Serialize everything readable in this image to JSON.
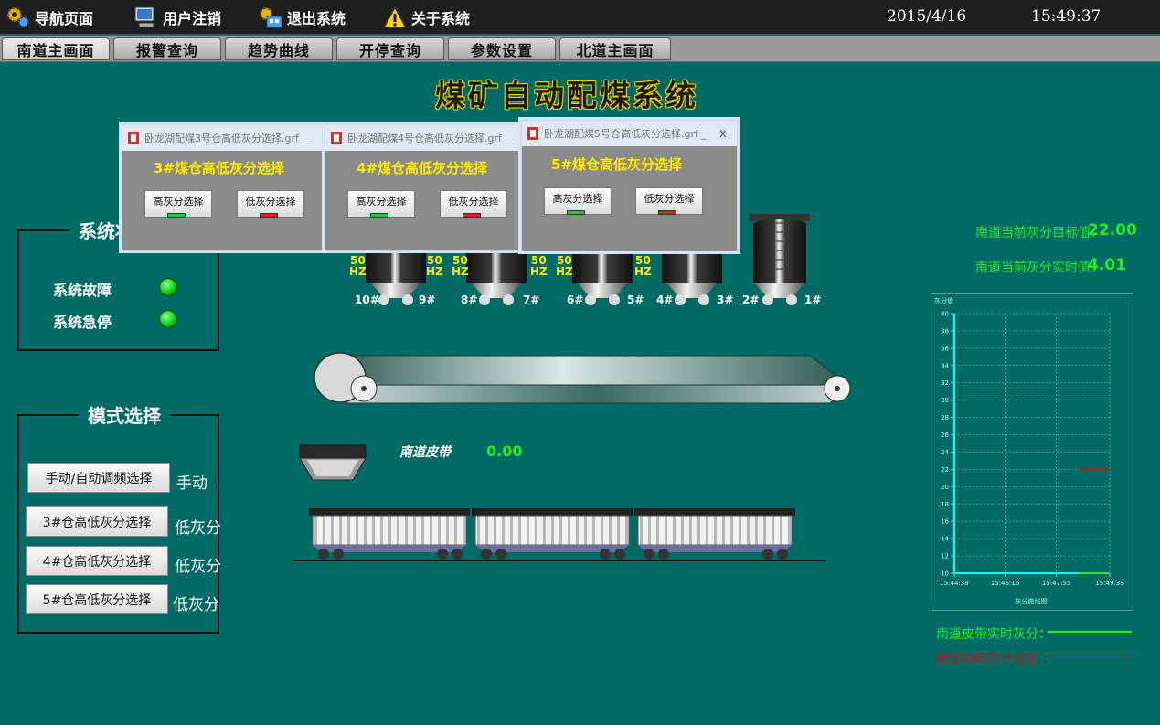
{
  "topbar": {
    "items": [
      {
        "label": "导航页面",
        "icon": "gear-icon"
      },
      {
        "label": "用户注销",
        "icon": "computer-icon"
      },
      {
        "label": "退出系统",
        "icon": "factory-icon"
      },
      {
        "label": "关于系统",
        "icon": "warning-icon"
      }
    ],
    "date": "2015/4/16",
    "time": "15:49:37"
  },
  "tabs": [
    "南道主画面",
    "报警查询",
    "趋势曲线",
    "开停查询",
    "参数设置",
    "北道主画面"
  ],
  "title": "煤矿自动配煤系统",
  "status_panel": {
    "title": "系统状态",
    "items": [
      "系统故障",
      "系统急停"
    ]
  },
  "mode_panel": {
    "title": "模式选择",
    "rows": [
      {
        "button": "手动/自动调频选择",
        "value": "手动"
      },
      {
        "button": "3#仓高低灰分选择",
        "value": "低灰分"
      },
      {
        "button": "4#仓高低灰分选择",
        "value": "低灰分"
      },
      {
        "button": "5#仓高低灰分选择",
        "value": "低灰分"
      }
    ]
  },
  "dialogs": [
    {
      "window_title": "卧龙湖配煤3号仓高低灰分选择.grf",
      "minimize": "_",
      "heading": "3#煤仓高低灰分选择",
      "high": "高灰分选择",
      "low": "低灰分选择"
    },
    {
      "window_title": "卧龙湖配煤4号仓高低灰分选择.grf",
      "minimize": "_",
      "heading": "4#煤仓高低灰分选择",
      "high": "高灰分选择",
      "low": "低灰分选择"
    },
    {
      "window_title": "卧龙湖配煤5号仓高低灰分选择.grf",
      "minimize": "_",
      "close": "x",
      "heading": "5#煤仓高低灰分选择",
      "high": "高灰分选择",
      "low": "低灰分选择"
    }
  ],
  "hz": {
    "value": "50",
    "unit": "HZ"
  },
  "silo_labels": [
    "10#",
    "9#",
    "8#",
    "7#",
    "6#",
    "5#",
    "4#",
    "3#",
    "2#",
    "1#"
  ],
  "belt": {
    "label": "南道皮带",
    "value": "0.00"
  },
  "info": {
    "target_label": "南道当前灰分目标值：",
    "target_value": "22.00",
    "actual_label": "南道当前灰分实时值：",
    "actual_value": "4.01"
  },
  "chart_data": {
    "type": "line",
    "title": "灰分值",
    "xlabel": "灰分曲线图",
    "ylim": [
      10,
      40
    ],
    "yticks": [
      10,
      12,
      14,
      16,
      18,
      20,
      22,
      24,
      26,
      28,
      30,
      32,
      34,
      36,
      38,
      40
    ],
    "xticks": [
      "15:44:38",
      "15:46:16",
      "15:47:55",
      "15:49:38"
    ],
    "grid": true,
    "series": [
      {
        "color": "#22ee22",
        "points": [
          [
            "15:48:40",
            10
          ],
          [
            "15:49:38",
            10
          ]
        ]
      },
      {
        "color": "#b02020",
        "points": [
          [
            "15:48:40",
            22
          ],
          [
            "15:49:38",
            22
          ]
        ]
      }
    ]
  },
  "legend": [
    {
      "label": "南道皮带实时灰分：",
      "color": "#22ee22"
    },
    {
      "label": "配煤系统灰分设定：",
      "color": "#b02020"
    }
  ],
  "colors": {
    "background": "#006a66",
    "accent": "#ffea00",
    "ok": "#00cc00",
    "alarm": "#e02020"
  }
}
